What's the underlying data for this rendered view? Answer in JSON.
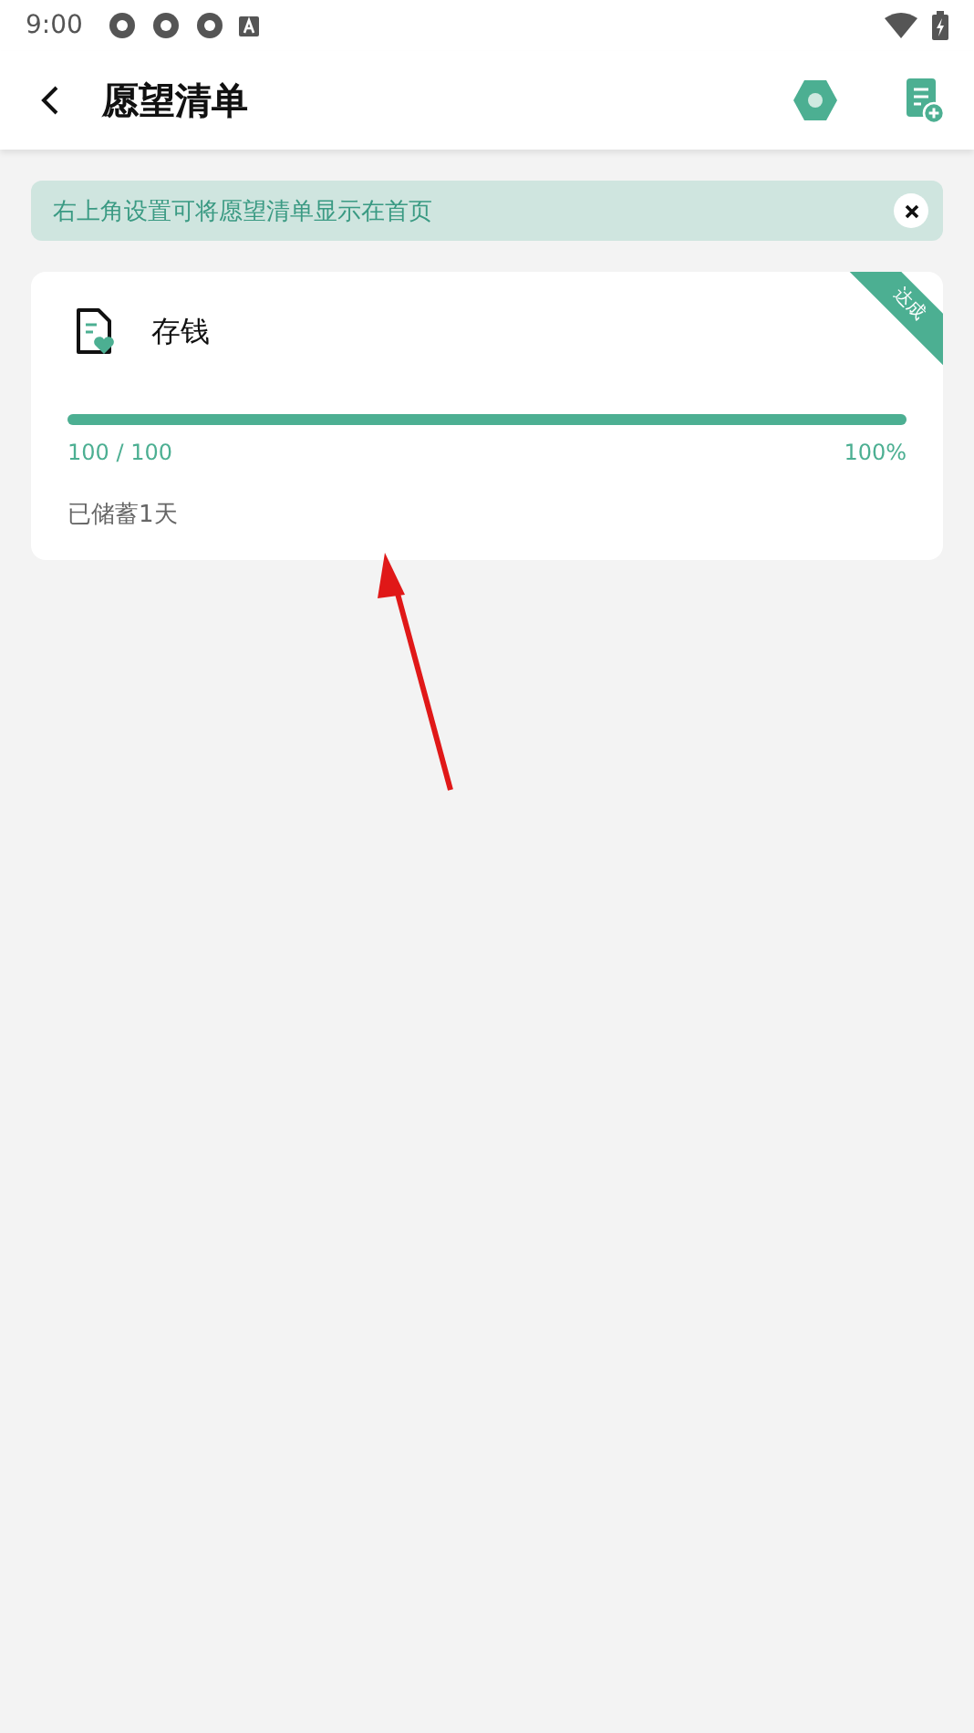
{
  "status_bar": {
    "time": "9:00"
  },
  "app_bar": {
    "title": "愿望清单"
  },
  "tip": {
    "text": "右上角设置可将愿望清单显示在首页"
  },
  "wishes": [
    {
      "name": "存钱",
      "badge": "达成",
      "level": 1.0,
      "amount": "100 / 100",
      "percent": "100%",
      "saved_days": "已储蓄1天"
    }
  ],
  "annotation": {
    "kind": "arrow"
  }
}
